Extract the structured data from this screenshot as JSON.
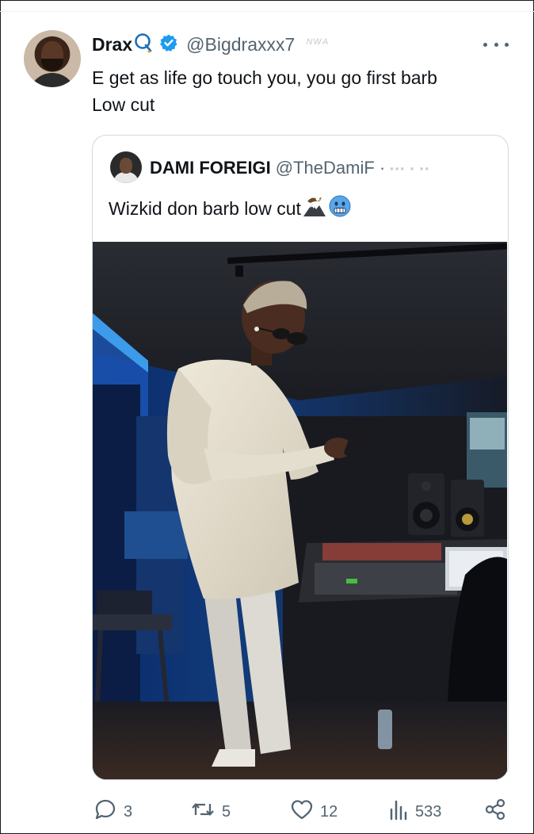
{
  "tweet": {
    "author_name": "Drax",
    "author_handle": "@Bigdraxxx7",
    "faded_label": "ᴺᵂᴬ",
    "text_line1": "E get as life go touch you, you go first barb",
    "text_line2": "Low cut"
  },
  "quoted": {
    "author_name": "DAMI FOREIGI",
    "author_handle": "@TheDamiF",
    "dot": "·",
    "text": "Wizkid don barb low cut"
  },
  "actions": {
    "replies": "3",
    "retweets": "5",
    "likes": "12",
    "views": "533"
  },
  "colors": {
    "verified_blue": "#1d9bf0",
    "q_icon_blue": "#1d6fb8",
    "muted": "#536471",
    "border": "#cfd9de"
  },
  "icons": [
    "q-icon",
    "verified-badge-icon",
    "more-icon",
    "eagle-mountain-emoji",
    "cold-face-emoji",
    "reply-icon",
    "retweet-icon",
    "like-icon",
    "views-icon",
    "share-icon"
  ]
}
